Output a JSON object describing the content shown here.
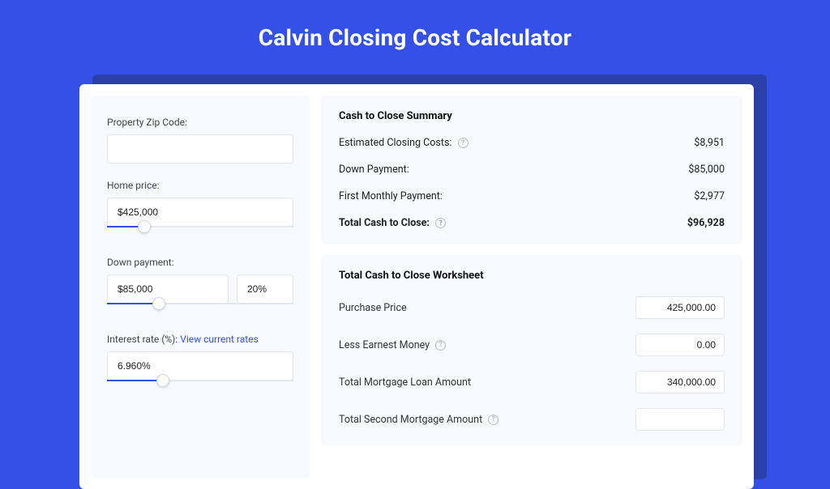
{
  "page": {
    "title": "Calvin Closing Cost Calculator"
  },
  "inputs": {
    "zip_label": "Property Zip Code:",
    "zip_value": "",
    "home_price_label": "Home price:",
    "home_price_value": "$425,000",
    "down_payment_label": "Down payment:",
    "down_payment_value": "$85,000",
    "down_payment_pct": "20%",
    "interest_label_prefix": "Interest rate (%): ",
    "interest_link": "View current rates",
    "interest_value": "6.960%"
  },
  "summary": {
    "title": "Cash to Close Summary",
    "rows": [
      {
        "label": "Estimated Closing Costs:",
        "help": true,
        "value": "$8,951"
      },
      {
        "label": "Down Payment:",
        "help": false,
        "value": "$85,000"
      },
      {
        "label": "First Monthly Payment:",
        "help": false,
        "value": "$2,977"
      }
    ],
    "total_label": "Total Cash to Close:",
    "total_value": "$96,928"
  },
  "worksheet": {
    "title": "Total Cash to Close Worksheet",
    "rows": [
      {
        "label": "Purchase Price",
        "help": false,
        "value": "425,000.00"
      },
      {
        "label": "Less Earnest Money",
        "help": true,
        "value": "0.00"
      },
      {
        "label": "Total Mortgage Loan Amount",
        "help": false,
        "value": "340,000.00"
      },
      {
        "label": "Total Second Mortgage Amount",
        "help": true,
        "value": ""
      }
    ]
  },
  "sliders": {
    "home_price_fill_pct": 20,
    "down_payment_fill_pct": 28,
    "interest_fill_pct": 30
  }
}
